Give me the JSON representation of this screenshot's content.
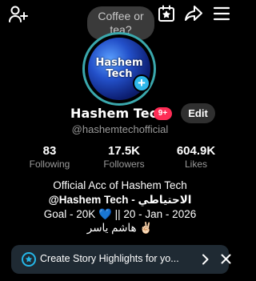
{
  "status_bubble": {
    "text": "Coffee or tea?"
  },
  "profile": {
    "avatar_line1": "Hashem",
    "avatar_line2": "Tech",
    "avatar_plus": "+",
    "name": "Hashem Tech",
    "notification_badge": "9+",
    "edit_label": "Edit",
    "handle": "@hashemtechofficial"
  },
  "stats": {
    "following": {
      "value": "83",
      "label": "Following"
    },
    "followers": {
      "value": "17.5K",
      "label": "Followers"
    },
    "likes": {
      "value": "604.9K",
      "label": "Likes"
    }
  },
  "bio": {
    "line1": "Official Acc of Hashem Tech",
    "line2": "@Hashem Tech - الاحتياطي",
    "line3_prefix": "Goal - 20K ",
    "line3_heart": "💙",
    "line3_suffix": " || 20 - Jan - 2026",
    "line4": "هاشم ياسر ✌🏻"
  },
  "banner": {
    "text": "Create Story Highlights for yo..."
  },
  "colors": {
    "avatar_ring": "#3aa8ad",
    "badge": "#fe2c55",
    "plus_button": "#2eb8ea",
    "banner_bg": "#1f2a33"
  },
  "icons": [
    "add-user-icon",
    "calendar-star-icon",
    "share-icon",
    "menu-icon",
    "highlight-icon",
    "chevron-right-icon",
    "close-icon"
  ]
}
